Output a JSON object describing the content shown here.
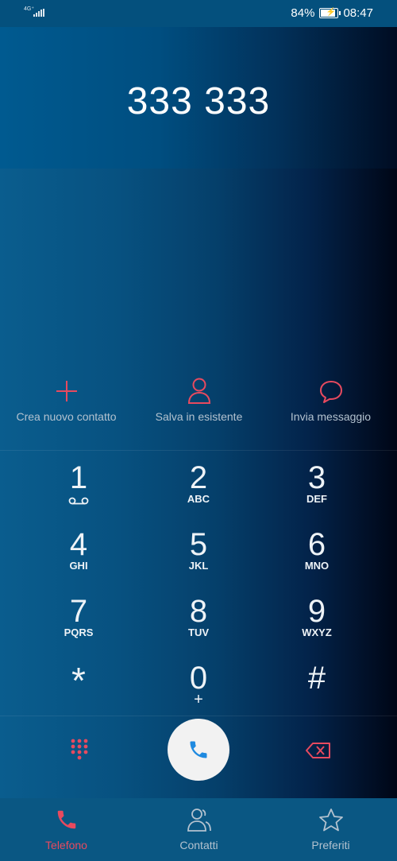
{
  "status_bar": {
    "network": "4G⁺",
    "battery": "84%",
    "time": "08:47"
  },
  "dialer": {
    "number": "333 333"
  },
  "actions": [
    {
      "label": "Crea nuovo contatto",
      "icon": "plus-icon"
    },
    {
      "label": "Salva in esistente",
      "icon": "person-icon"
    },
    {
      "label": "Invia messaggio",
      "icon": "message-bubble-icon"
    }
  ],
  "keypad": {
    "k1": {
      "digit": "1",
      "letters": ""
    },
    "k2": {
      "digit": "2",
      "letters": "ABC"
    },
    "k3": {
      "digit": "3",
      "letters": "DEF"
    },
    "k4": {
      "digit": "4",
      "letters": "GHI"
    },
    "k5": {
      "digit": "5",
      "letters": "JKL"
    },
    "k6": {
      "digit": "6",
      "letters": "MNO"
    },
    "k7": {
      "digit": "7",
      "letters": "PQRS"
    },
    "k8": {
      "digit": "8",
      "letters": "TUV"
    },
    "k9": {
      "digit": "9",
      "letters": "WXYZ"
    },
    "kstar": {
      "digit": "*",
      "letters": ""
    },
    "k0": {
      "digit": "0",
      "letters": "+"
    },
    "khash": {
      "digit": "#",
      "letters": ""
    }
  },
  "nav": {
    "phone": "Telefono",
    "contacts": "Contatti",
    "favorites": "Preferiti"
  },
  "colors": {
    "accent": "#e84a5f",
    "call_icon": "#1f8ae0",
    "inactive": "#b3c2cf"
  }
}
